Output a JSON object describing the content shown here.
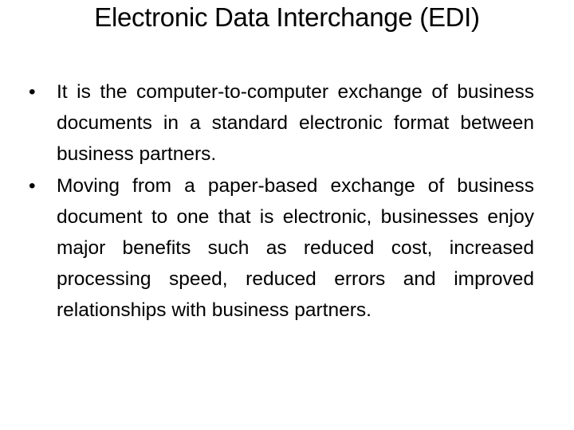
{
  "slide": {
    "title": "Electronic Data Interchange (EDI)",
    "bullets": [
      {
        "marker": "•",
        "text": "It is the computer-to-computer exchange of business documents in a standard electronic format between business partners."
      },
      {
        "marker": "•",
        "text": "Moving from a paper-based exchange of business document to one that is electronic, businesses enjoy major benefits such as reduced cost, increased processing speed, reduced errors and improved relationships with business partners."
      }
    ]
  }
}
